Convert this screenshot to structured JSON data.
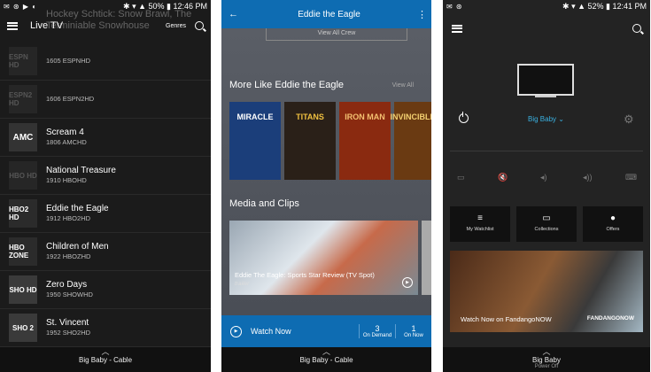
{
  "colors": {
    "accent_blue": "#0e6cb2",
    "device_teal": "#3ab0e0"
  },
  "panel1": {
    "status": {
      "left": "✉ ⊛ ▶ ◐",
      "right": "✱ ▾ ▲ 50% ▮ 12:46 PM"
    },
    "header": {
      "title": "Live TV",
      "genres": "Genres"
    },
    "ghost_text": [
      "Hockey Schtick: Snow Brawl, The",
      "Terminiable Snowhouse"
    ],
    "channels": [
      {
        "logo": "ESPN HD",
        "title": "",
        "number": "1605 ESPNHD"
      },
      {
        "logo": "ESPN2 HD",
        "title": "",
        "number": "1606 ESPN2HD"
      },
      {
        "logo": "AMC",
        "title": "Scream 4",
        "number": "1806 AMCHD"
      },
      {
        "logo": "HBO HD",
        "title": "National Treasure",
        "number": "1910 HBOHD"
      },
      {
        "logo": "HBO2 HD",
        "title": "Eddie the Eagle",
        "number": "1912 HBO2HD"
      },
      {
        "logo": "HBO ZONE",
        "title": "Children of Men",
        "number": "1922 HBOZHD"
      },
      {
        "logo": "SHO HD",
        "title": "Zero Days",
        "number": "1950 SHOWHD"
      },
      {
        "logo": "SHO 2",
        "title": "St. Vincent",
        "number": "1952 SHO2HD"
      }
    ],
    "bottom": {
      "caption": "Big Baby - Cable"
    }
  },
  "panel2": {
    "header": {
      "title": "Eddie the Eagle"
    },
    "view_all_crew": "View All Crew",
    "more_like": {
      "title": "More Like Eddie the Eagle",
      "view_all": "View All"
    },
    "posters": [
      {
        "title": "MIRACLE",
        "color": "#1b3e7a"
      },
      {
        "title": "TITANS",
        "color": "#2a2018"
      },
      {
        "title": "IRON MAN",
        "color": "#8a2a10"
      },
      {
        "title": "INVINCIBLE",
        "color": "#6a3a12"
      }
    ],
    "media": {
      "title": "Media and Clips",
      "clip_title": "Eddie The Eagle: Sports Star Review (TV Spot)",
      "clip_type": "trailer"
    },
    "watch": {
      "label": "Watch Now",
      "on_demand_count": "3",
      "on_demand_label": "On Demand",
      "on_now_count": "1",
      "on_now_label": "On Now"
    },
    "bottom": {
      "caption": "Big Baby - Cable"
    }
  },
  "panel3": {
    "status": {
      "left": "✉ ⊛",
      "right": "✱ ▾ ▲ 52% ▮ 12:41 PM"
    },
    "device": "Big Baby ⌄",
    "tiles": [
      {
        "icon": "≡",
        "label": "My Watchlist"
      },
      {
        "icon": "▭",
        "label": "Collections"
      },
      {
        "icon": "●",
        "label": "Offers"
      }
    ],
    "banner": {
      "caption": "Watch Now on FandangoNOW",
      "brand": "FANDANGONOW"
    },
    "bottom": {
      "caption": "Big Baby",
      "sub": "Power Off"
    }
  }
}
